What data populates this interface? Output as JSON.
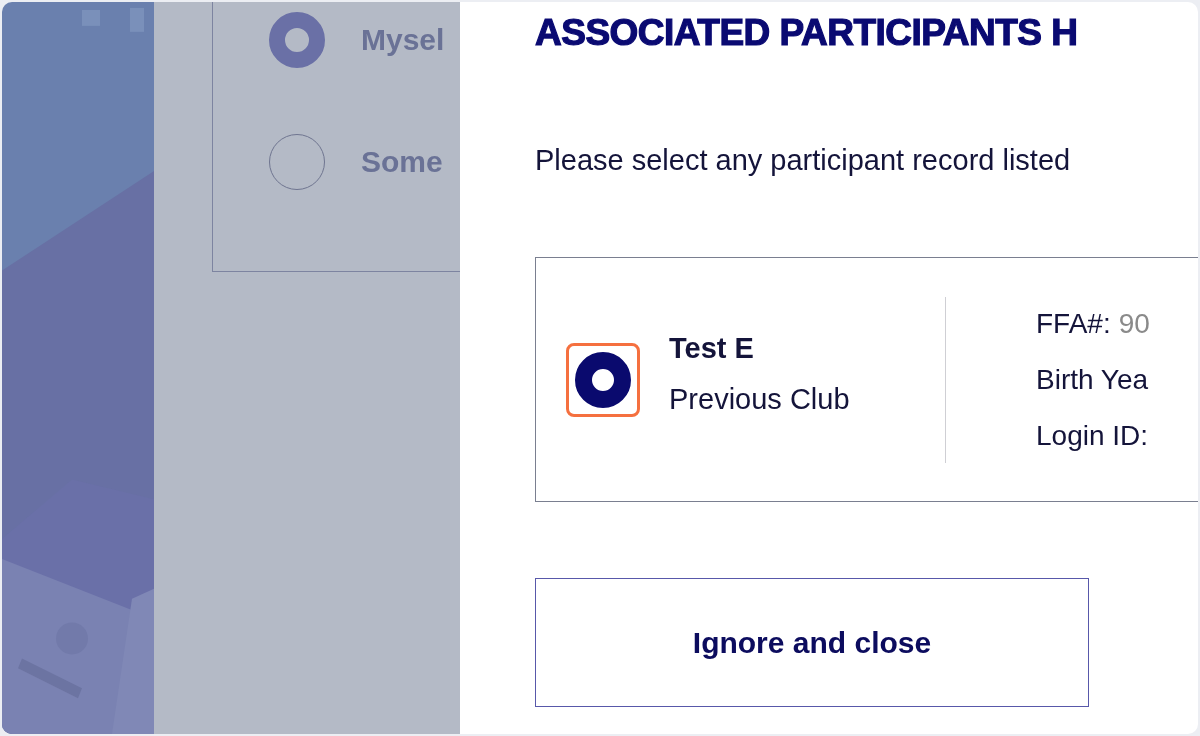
{
  "background_form": {
    "options": [
      {
        "label": "Mysel",
        "selected": true
      },
      {
        "label": "Some",
        "selected": false
      }
    ]
  },
  "dialog": {
    "title": "ASSOCIATED PARTICIPANTS H",
    "instruction": "Please select any participant record listed",
    "records": [
      {
        "name": "Test E",
        "club": "Previous Club",
        "selected": true,
        "highlighted": true,
        "fields": [
          {
            "label": "FFA#:",
            "value": "90"
          },
          {
            "label": "Birth Yea"
          },
          {
            "label": "Login ID:"
          }
        ]
      }
    ],
    "buttons": [
      "Ignore and close"
    ]
  }
}
